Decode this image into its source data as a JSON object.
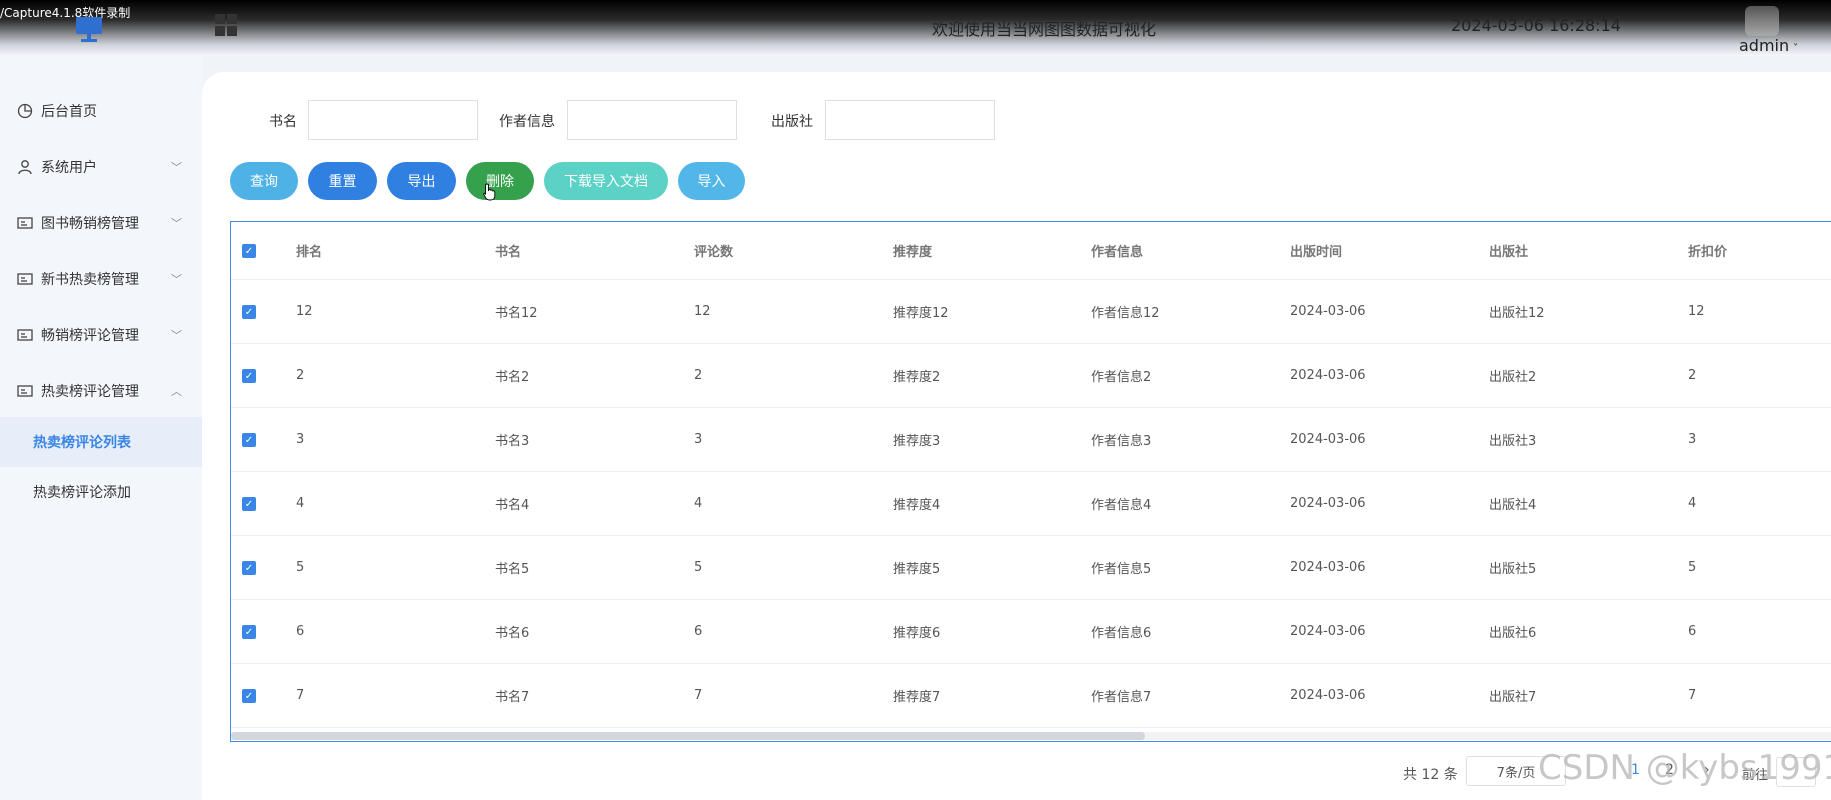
{
  "recorder": {
    "label": "/Capture4.1.8软件录制"
  },
  "header": {
    "welcome": "欢迎使用当当网图图数据可视化",
    "datetime": "2024-03-06 16:28:14",
    "user": "admin",
    "user_caret": "˅"
  },
  "sidebar": {
    "items": [
      {
        "label": "后台首页",
        "icon": "clock-icon"
      },
      {
        "label": "系统用户",
        "icon": "user-icon",
        "arrow": "﹀"
      },
      {
        "label": "图书畅销榜管理",
        "icon": "card-icon",
        "arrow": "﹀"
      },
      {
        "label": "新书热卖榜管理",
        "icon": "card-icon",
        "arrow": "﹀"
      },
      {
        "label": "畅销榜评论管理",
        "icon": "card-icon",
        "arrow": "﹀"
      },
      {
        "label": "热卖榜评论管理",
        "icon": "card-icon",
        "arrow": "︿"
      }
    ],
    "submenu": [
      {
        "label": "热卖榜评论列表",
        "active": true
      },
      {
        "label": "热卖榜评论添加",
        "active": false
      }
    ]
  },
  "search": {
    "title_label": "书名",
    "author_label": "作者信息",
    "publisher_label": "出版社"
  },
  "toolbar": {
    "query": "查询",
    "reset": "重置",
    "export": "导出",
    "delete": "删除",
    "download": "下载导入文档",
    "import": "导入"
  },
  "table": {
    "columns": [
      "排名",
      "书名",
      "评论数",
      "推荐度",
      "作者信息",
      "出版时间",
      "出版社",
      "折扣价"
    ],
    "rows": [
      [
        "12",
        "书名12",
        "12",
        "推荐度12",
        "作者信息12",
        "2024-03-06",
        "出版社12",
        "12"
      ],
      [
        "2",
        "书名2",
        "2",
        "推荐度2",
        "作者信息2",
        "2024-03-06",
        "出版社2",
        "2"
      ],
      [
        "3",
        "书名3",
        "3",
        "推荐度3",
        "作者信息3",
        "2024-03-06",
        "出版社3",
        "3"
      ],
      [
        "4",
        "书名4",
        "4",
        "推荐度4",
        "作者信息4",
        "2024-03-06",
        "出版社4",
        "4"
      ],
      [
        "5",
        "书名5",
        "5",
        "推荐度5",
        "作者信息5",
        "2024-03-06",
        "出版社5",
        "5"
      ],
      [
        "6",
        "书名6",
        "6",
        "推荐度6",
        "作者信息6",
        "2024-03-06",
        "出版社6",
        "6"
      ],
      [
        "7",
        "书名7",
        "7",
        "推荐度7",
        "作者信息7",
        "2024-03-06",
        "出版社7",
        "7"
      ]
    ],
    "check_glyph": "✓"
  },
  "pagination": {
    "total": "共 12 条",
    "page_size": "7条/页",
    "page_1": "1",
    "page_2": "2",
    "next": "›",
    "goto": "前往"
  },
  "watermark": "CSDN @kybs1991",
  "colors": {
    "primary": "#2f80e0",
    "query": "#4fb2e6",
    "delete": "#36a14d",
    "download": "#5cd1c6",
    "active_menu": "#3a86e6"
  }
}
